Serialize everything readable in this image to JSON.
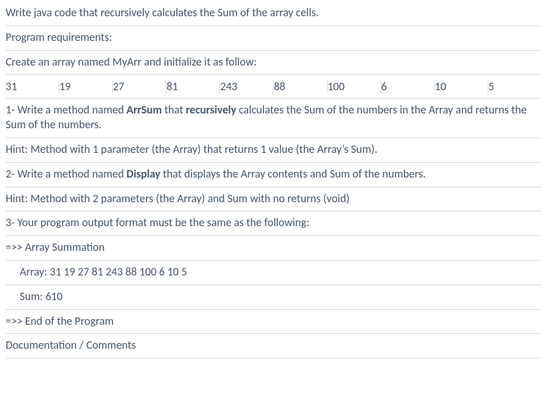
{
  "title": "Write java code that recursively calculates the Sum of the array cells.",
  "req_header": "Program requirements:",
  "create_array": "Create an array named MyArr and initialize it as follow:",
  "array_values": [
    "31",
    "19",
    "27",
    "81",
    "243",
    "88",
    "100",
    "6",
    "10",
    "5"
  ],
  "step1_a": "1-  Write a method named ",
  "step1_b": "ArrSum",
  "step1_c": " that ",
  "step1_d": "recursively",
  "step1_e": " calculates the Sum of the numbers in the Array and returns the Sum of the numbers.",
  "hint1": "Hint: Method with 1 parameter (the Array) that returns 1 value (the Array’s Sum).",
  "step2_a": "2- Write a method named ",
  "step2_b": "Display",
  "step2_c": " that displays the Array contents and Sum of the numbers.",
  "hint2": "Hint: Method with 2 parameters (the Array) and Sum with no returns (void)",
  "step3": "3-  Your program output format must be the same as the  following:",
  "out1": "=>> Array Summation",
  "out2": "Array: 31 19 27 81 243 88 100 6 10 5",
  "out3": "Sum: 610",
  "out4": "=>> End of the Program",
  "doc": "Documentation / Comments"
}
